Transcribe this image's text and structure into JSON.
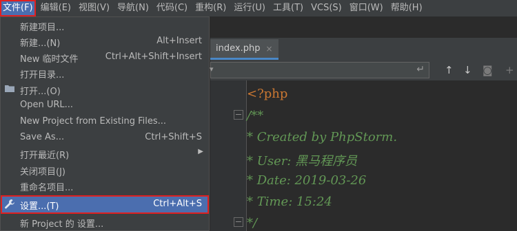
{
  "menubar": {
    "items": [
      {
        "label": "文件(F)",
        "active": true
      },
      {
        "label": "编辑(E)"
      },
      {
        "label": "视图(V)"
      },
      {
        "label": "导航(N)"
      },
      {
        "label": "代码(C)"
      },
      {
        "label": "重构(R)"
      },
      {
        "label": "运行(U)"
      },
      {
        "label": "工具(T)"
      },
      {
        "label": "VCS(S)"
      },
      {
        "label": "窗口(W)"
      },
      {
        "label": "帮助(H)"
      }
    ]
  },
  "file_menu": {
    "items": [
      {
        "label": "新建项目...",
        "shortcut": ""
      },
      {
        "label": "新建...(N)",
        "shortcut": "Alt+Insert"
      },
      {
        "label": "New 临时文件",
        "shortcut": "Ctrl+Alt+Shift+Insert"
      },
      {
        "label": "打开目录...",
        "shortcut": ""
      },
      {
        "label": "打开...(O)",
        "shortcut": "",
        "icon": "folder-icon"
      },
      {
        "label": "Open URL...",
        "shortcut": ""
      },
      {
        "label": "New Project from Existing Files...",
        "shortcut": ""
      },
      {
        "label": "Save As...",
        "shortcut": "Ctrl+Shift+S"
      },
      {
        "label": "打开最近(R)",
        "shortcut": "",
        "submenu": true
      },
      {
        "label": "关闭项目(J)",
        "shortcut": ""
      },
      {
        "label": "重命名项目...",
        "shortcut": ""
      },
      {
        "label": "设置...(T)",
        "shortcut": "Ctrl+Alt+S",
        "icon": "wrench-icon",
        "selected": true
      },
      {
        "label": "新 Project 的 设置...",
        "shortcut": ""
      }
    ]
  },
  "editor": {
    "tab_label": "index.php",
    "tab_close": "×",
    "code_lines": [
      "<?php",
      "/**",
      " * Created by PhpStorm.",
      " * User: 黑马程序员",
      " * Date: 2019-03-26",
      " * Time: 15:24",
      " */"
    ]
  },
  "colors": {
    "menu_bg": "#3c3f41",
    "selection": "#4b6eaf",
    "highlight_border": "#e02020",
    "php_tag": "#cc7832",
    "comment": "#629755"
  }
}
